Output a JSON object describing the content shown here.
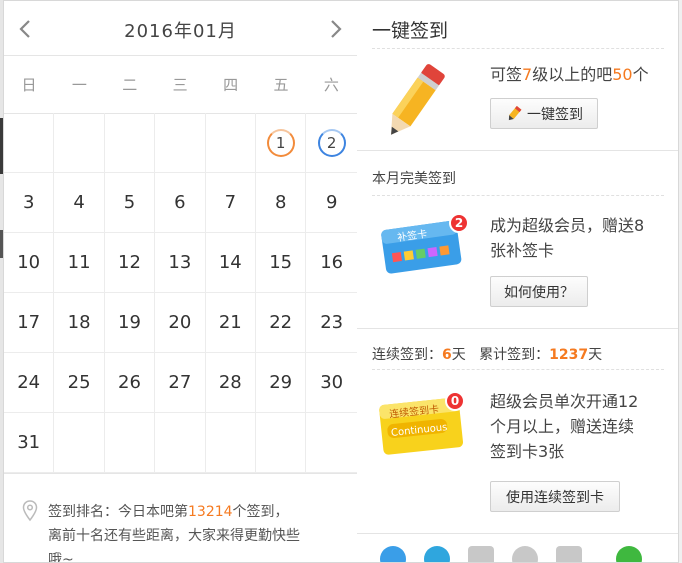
{
  "calendar": {
    "month_label": "2016年01月",
    "weekdays": [
      "日",
      "一",
      "二",
      "三",
      "四",
      "五",
      "六"
    ],
    "signed_days": [
      1,
      2
    ],
    "weeks": [
      [
        "",
        "",
        "",
        "",
        "",
        "1",
        "2"
      ],
      [
        "3",
        "4",
        "5",
        "6",
        "7",
        "8",
        "9"
      ],
      [
        "10",
        "11",
        "12",
        "13",
        "14",
        "15",
        "16"
      ],
      [
        "17",
        "18",
        "19",
        "20",
        "21",
        "22",
        "23"
      ],
      [
        "24",
        "25",
        "26",
        "27",
        "28",
        "29",
        "30"
      ],
      [
        "31",
        "",
        "",
        "",
        "",
        "",
        ""
      ]
    ],
    "rank": {
      "p1": "签到排名：今日本吧第",
      "num": "13214",
      "p2": "个签到，",
      "line2": "离前十名还有些距离，大家来得更勤快些",
      "line3": "哦~"
    }
  },
  "one_click": {
    "title": "一键签到",
    "desc_a": "可签",
    "level": "7",
    "desc_b": "级以上的吧",
    "count": "50",
    "desc_c": "个",
    "button": "一键签到"
  },
  "perfect": {
    "title": "本月完美签到",
    "desc_line1": "成为超级会员，赠送8",
    "desc_line2": "张补签卡",
    "badge": "2",
    "card_label": "补签卡",
    "button": "如何使用？"
  },
  "streak": {
    "continuous_label": "连续签到：",
    "continuous_value": "6",
    "continuous_unit": "天",
    "total_label": "累计签到：",
    "total_value": "1237",
    "total_unit": "天",
    "desc_line1": "超级会员单次开通12",
    "desc_line2": "个月以上，赠送连续",
    "desc_line3": "签到卡3张",
    "badge": "0",
    "card_label": "连续签到卡",
    "card_sub": "Continuous",
    "button": "使用连续签到卡"
  },
  "colors": {
    "accent": "#f57a20",
    "badge": "#e33333",
    "blue_ring": "#3d84e0",
    "orange_ring": "#f28b3b"
  }
}
